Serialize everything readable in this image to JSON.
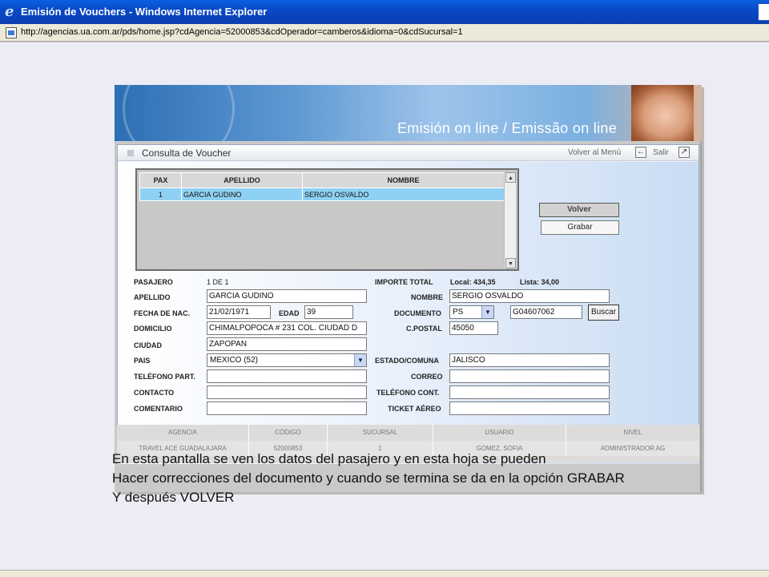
{
  "window": {
    "title": "Emisión de Vouchers - Windows Internet Explorer",
    "url": "http://agencias.ua.com.ar/pds/home.jsp?cdAgencia=52000853&cdOperador=camberos&idioma=0&cdSucursal=1"
  },
  "banner": {
    "title": "Emisión on line / Emissão on line"
  },
  "panel": {
    "title": "Consulta de Voucher",
    "volver_menu": "Volver al Menú",
    "salir": "Salir"
  },
  "grid": {
    "headers": [
      "PAX",
      "APELLIDO",
      "NOMBRE"
    ],
    "rows": [
      {
        "pax": "1",
        "apellido": "GARCIA GUDINO",
        "nombre": "SERGIO OSVALDO"
      }
    ]
  },
  "buttons": {
    "volver": "Volver",
    "grabar": "Grabar",
    "buscar": "Buscar"
  },
  "form": {
    "pasajero_label": "PASAJERO",
    "pasajero_value": "1 DE 1",
    "importe_label": "IMPORTE TOTAL",
    "importe_local": "Local: 434,35",
    "importe_lista": "Lista: 34,00",
    "apellido_label": "APELLIDO",
    "apellido": "GARCIA GUDINO",
    "nombre_label": "NOMBRE",
    "nombre": "SERGIO OSVALDO",
    "fecha_label": "FECHA DE NAC.",
    "fecha": "21/02/1971",
    "edad_label": "EDAD",
    "edad": "39",
    "documento_label": "DOCUMENTO",
    "documento_tipo": "PS",
    "documento_numero": "G04607062",
    "domicilio_label": "DOMICILIO",
    "domicilio": "CHIMALPOPOCA # 231 COL. CIUDAD D",
    "cpostal_label": "C.POSTAL",
    "cpostal": "45050",
    "ciudad_label": "CIUDAD",
    "ciudad": "ZAPOPAN",
    "pais_label": "PAIS",
    "pais": "MEXICO (52)",
    "estado_label": "ESTADO/COMUNA",
    "estado": "JALISCO",
    "telpart_label": "TELÉFONO PART.",
    "telpart": "",
    "correo_label": "CORREO",
    "correo": "",
    "contacto_label": "CONTACTO",
    "contacto": "",
    "telcont_label": "TELÉFONO CONT.",
    "telcont": "",
    "comentario_label": "COMENTARIO",
    "comentario": "",
    "ticket_label": "TICKET AÉREO",
    "ticket": ""
  },
  "info": {
    "headers": [
      "AGENCIA",
      "CÓDIGO",
      "SUCURSAL",
      "USUARIO",
      "NIVEL"
    ],
    "values": [
      "TRAVEL ACE GUADALAJARA",
      "52000853",
      "1",
      "GOMEZ, SOFIA",
      "ADMINISTRADOR AG"
    ]
  },
  "caption": {
    "line1": "En esta pantalla se ven los datos del pasajero y en esta hoja se pueden",
    "line2": "Hacer correcciones del documento y cuando se termina se da en la opción GRABAR",
    "line3": "Y después VOLVER"
  }
}
